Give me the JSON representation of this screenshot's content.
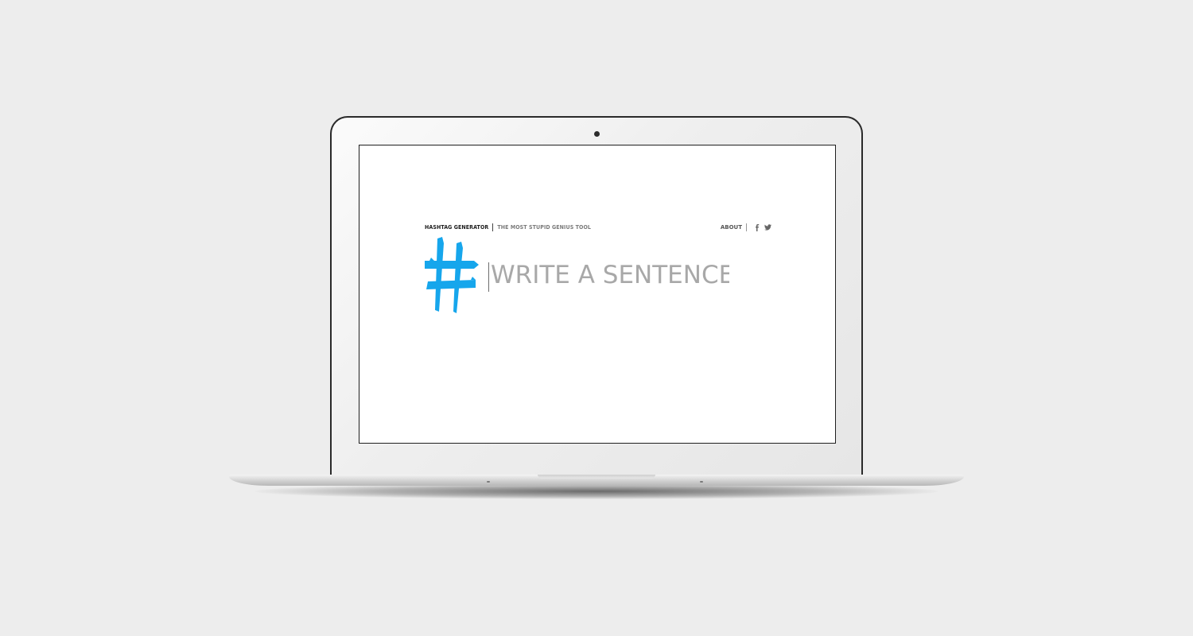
{
  "site": {
    "brand_name": "HASHTAG GENERATOR",
    "tagline": "THE MOST STUPID GENIUS TOOL",
    "nav": {
      "about_label": "ABOUT",
      "facebook_icon": "f",
      "twitter_icon": "twitter-bird"
    },
    "hero": {
      "logo_icon": "hash-icon",
      "input_placeholder": "WRITE A SENTENCE",
      "input_value": ""
    },
    "colors": {
      "accent": "#16a6ec",
      "page_background": "#ededed",
      "screen_background": "#ffffff",
      "placeholder_text": "#a8a8a8"
    }
  }
}
